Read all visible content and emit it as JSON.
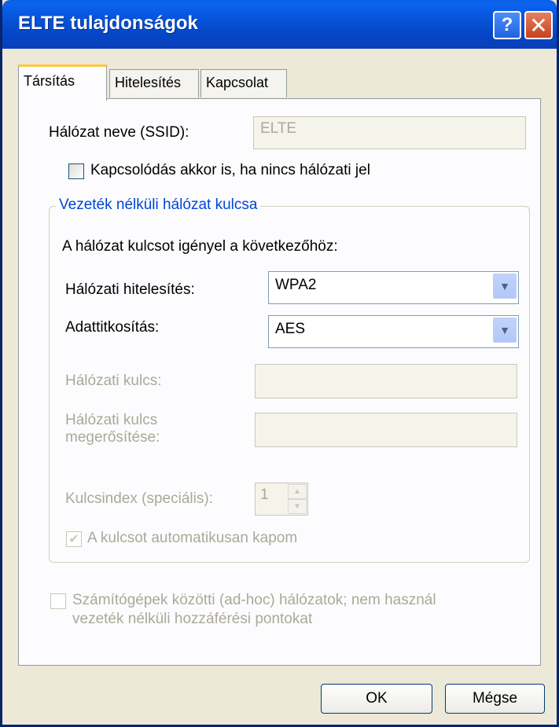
{
  "window": {
    "title": "ELTE tulajdonságok",
    "help_glyph": "?",
    "close_glyph": "✕"
  },
  "tabs": [
    {
      "label": "Társítás",
      "active": true
    },
    {
      "label": "Hitelesítés",
      "active": false
    },
    {
      "label": "Kapcsolat",
      "active": false
    }
  ],
  "ssid": {
    "label": "Hálózat neve (SSID):",
    "value": "ELTE"
  },
  "connect_even_if_not_broadcasting": {
    "label": "Kapcsolódás akkor is, ha nincs hálózati jel",
    "checked": false
  },
  "wireless_key": {
    "group_title": "Vezeték nélküli hálózat kulcsa",
    "intro": "A hálózat kulcsot igényel a következőhöz:",
    "auth_label": "Hálózati hitelesítés:",
    "auth_value": "WPA2",
    "encryption_label": "Adattitkosítás:",
    "encryption_value": "AES",
    "network_key_label": "Hálózati kulcs:",
    "network_key_value": "",
    "confirm_key_label_line1": "Hálózati kulcs",
    "confirm_key_label_line2": "megerősítése:",
    "confirm_key_value": "",
    "key_index_label": "Kulcsindex (speciális):",
    "key_index_value": "1",
    "auto_key_label": "A kulcsot automatikusan kapom",
    "auto_key_checked": true
  },
  "adhoc": {
    "label_line1": "Számítógépek közötti (ad-hoc) hálózatok; nem használ",
    "label_line2": "vezeték nélküli hozzáférési pontokat",
    "checked": false
  },
  "buttons": {
    "ok": "OK",
    "cancel": "Mégse"
  },
  "colors": {
    "titlebar": "#0653d8",
    "group_title": "#0046d5",
    "tab_highlight": "#ffc83c"
  }
}
